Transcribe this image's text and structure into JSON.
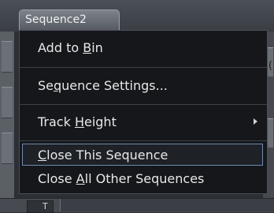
{
  "tab": {
    "title": "Sequence2"
  },
  "background": {
    "right_glyph": ")(",
    "bottom_glyph": "T"
  },
  "menu": {
    "items": [
      {
        "pre": "Add to ",
        "mnemonic": "B",
        "post": "in",
        "has_submenu": false,
        "highlighted": false
      },
      {
        "pre": "Se",
        "mnemonic": "q",
        "post": "uence Settings...",
        "has_submenu": false,
        "highlighted": false
      },
      {
        "pre": "Track ",
        "mnemonic": "H",
        "post": "eight",
        "has_submenu": true,
        "highlighted": false
      },
      {
        "pre": "",
        "mnemonic": "C",
        "post": "lose This Sequence",
        "has_submenu": false,
        "highlighted": true
      },
      {
        "pre": "Close ",
        "mnemonic": "A",
        "post": "ll Other Sequences",
        "has_submenu": false,
        "highlighted": false
      }
    ]
  }
}
